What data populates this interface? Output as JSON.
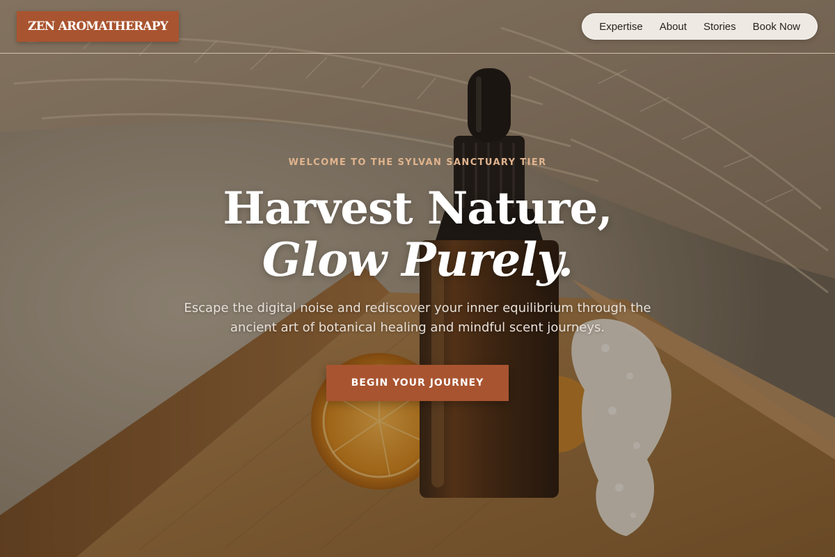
{
  "brand": {
    "name": "ZEN AROMATHERAPY",
    "color": "#a95430"
  },
  "nav": {
    "links": [
      {
        "label": "Expertise"
      },
      {
        "label": "About"
      },
      {
        "label": "Stories"
      },
      {
        "label": "Book Now"
      }
    ]
  },
  "hero": {
    "eyebrow": "WELCOME TO THE SYLVAN SANCTUARY TIER",
    "headline_line1": "Harvest Nature,",
    "headline_line2": "Glow Purely.",
    "subtitle": "Escape the digital noise and rediscover your inner equilibrium through the ancient art of botanical healing and mindful scent journeys.",
    "cta_label": "BEGIN YOUR JOURNEY",
    "background_image_subject": "amber dropper bottle on wooden tray with dried orange slice, moss and pampas grass"
  },
  "colors": {
    "accent": "#a95430",
    "eyebrow": "#e0b48e",
    "headline": "#ffffff",
    "nav_pill": "#f8f3ee"
  }
}
